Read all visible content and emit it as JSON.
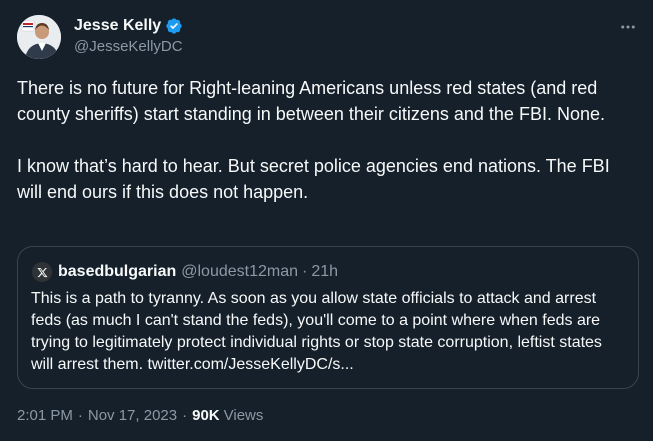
{
  "author": {
    "name": "Jesse Kelly",
    "handle": "@JesseKellyDC",
    "verified": true
  },
  "tweet": {
    "text": "There is no future for Right-leaning Americans unless red states (and red county sheriffs) start standing in between their citizens and the FBI. None.\n\nI know that’s hard to hear. But secret police agencies end nations. The FBI will end ours if this does not happen.",
    "time": "2:01 PM",
    "date": "Nov 17, 2023",
    "views_count": "90K",
    "views_label": "Views",
    "separator": "·"
  },
  "quote": {
    "name": "basedbulgarian",
    "handle": "@loudest12man",
    "time": "21h",
    "text": "This is a path to tyranny. As soon as you allow state officials to attack and arrest feds (as much I can't stand the feds), you'll come to a point where when feds are trying to legitimately protect individual rights or stop state corruption, leftist states will arrest them. twitter.com/JesseKellyDC/s..."
  },
  "colors": {
    "background": "#15202b",
    "text": "#f7f9f9",
    "muted": "#8b98a5",
    "verified_blue": "#1d9bf0",
    "border": "#38444d"
  },
  "icons": {
    "verified": "verified-badge-icon",
    "more": "more-dots-icon",
    "x_logo": "x-logo-icon"
  }
}
